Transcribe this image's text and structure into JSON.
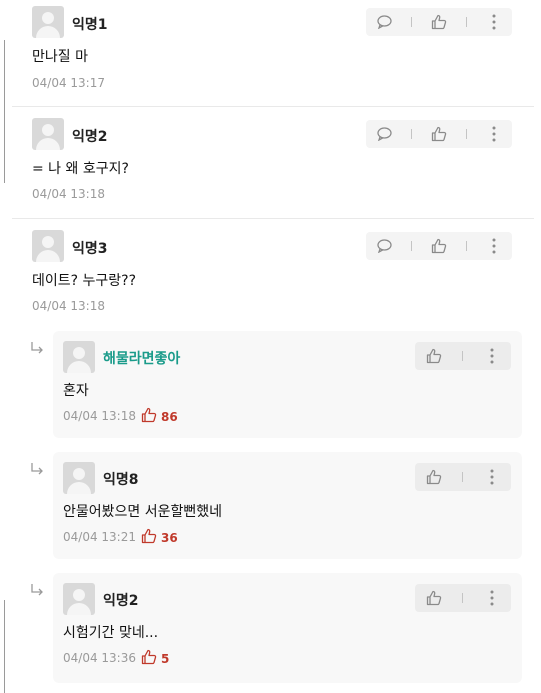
{
  "comments": [
    {
      "author": "익명1",
      "text": "만나질 마",
      "time": "04/04 13:17"
    },
    {
      "author": "익명2",
      "text": "= 나 왜 호구지?",
      "time": "04/04 13:18"
    },
    {
      "author": "익명3",
      "text": "데이트? 누구랑??",
      "time": "04/04 13:18"
    }
  ],
  "replies": [
    {
      "author": "해물라면좋아",
      "text": "혼자",
      "time": "04/04 13:18",
      "likes": "86"
    },
    {
      "author": "익명8",
      "text": "안물어봤으면 서운할뻔했네",
      "time": "04/04 13:21",
      "likes": "36"
    },
    {
      "author": "익명2",
      "text": "시험기간 맞네...",
      "time": "04/04 13:36",
      "likes": "5"
    }
  ],
  "colors": {
    "accent_name": "#1a9b8a",
    "like": "#c0392b"
  },
  "icons": {
    "comment": "speech-bubble-icon",
    "like": "thumbs-up-icon",
    "more": "more-vertical-icon",
    "reply": "reply-arrow-icon"
  }
}
